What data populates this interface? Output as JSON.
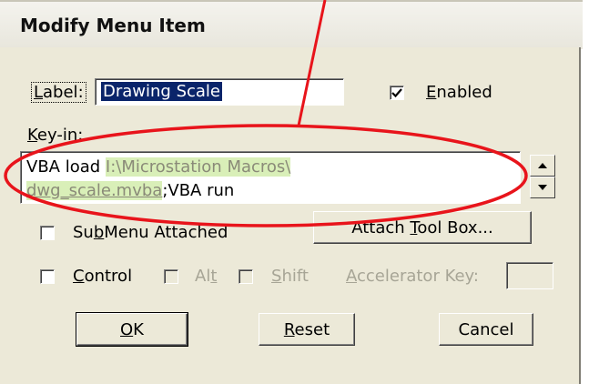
{
  "dialog": {
    "title": "Modify Menu Item",
    "label_caption": "Label:",
    "label_value": "Drawing Scale",
    "enabled_label": "Enabled",
    "enabled_checked": true,
    "keyin_caption": "Key-in:",
    "keyin_line1": {
      "prefix": "VBA load ",
      "path": "I:\\Microstation Macros\\"
    },
    "keyin_line2": {
      "file": "dwg_scale.mvba",
      "suffix": ";VBA run"
    },
    "submenu_label": "SubMenu Attached",
    "attach_toolbox_label": "Attach Tool Box...",
    "control_label": "Control",
    "alt_label": "Alt",
    "shift_label": "Shift",
    "accelerator_label": "Accelerator Key:",
    "accelerator_value": "",
    "ok_label": "OK",
    "reset_label": "Reset",
    "cancel_label": "Cancel"
  },
  "colors": {
    "annotation": "#e8141b",
    "highlight": "#d9efb8",
    "dialog_bg": "#ece9d8"
  }
}
